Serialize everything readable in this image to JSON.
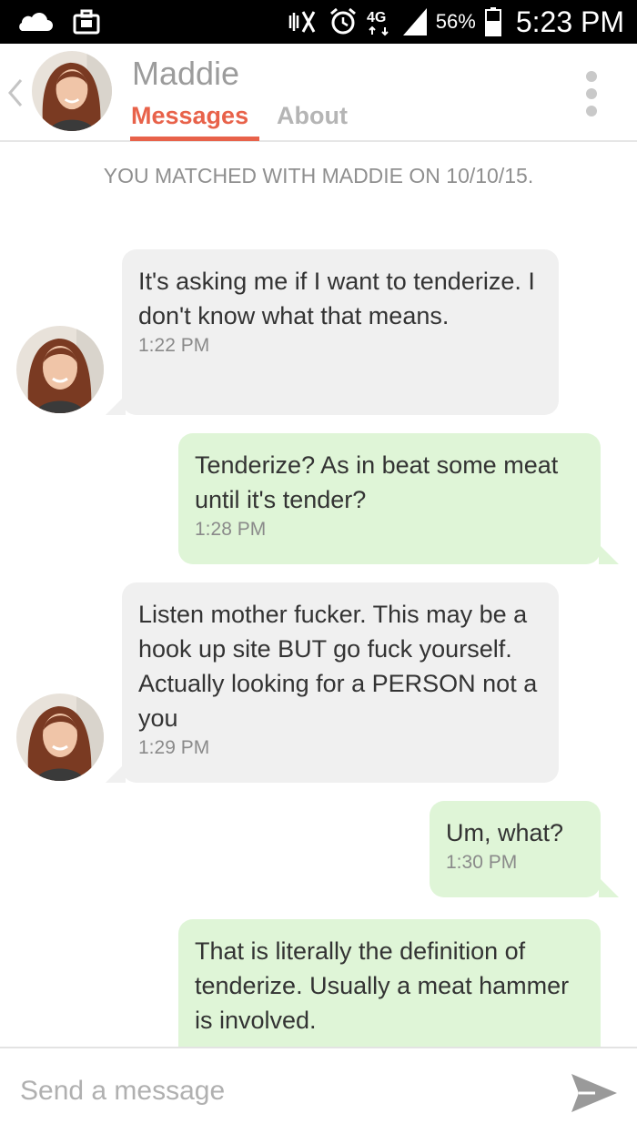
{
  "status_bar": {
    "battery": "56%",
    "time": "5:23 PM",
    "network": "4G",
    "icons": [
      "cloud-icon",
      "briefcase-icon",
      "mute-icon",
      "alarm-icon",
      "signal-icon",
      "battery-icon"
    ]
  },
  "header": {
    "name": "Maddie",
    "tabs": [
      {
        "label": "Messages",
        "active": true
      },
      {
        "label": "About",
        "active": false
      }
    ],
    "accent_color": "#e8624a"
  },
  "conversation": {
    "match_note": "YOU MATCHED WITH MADDIE ON 10/10/15.",
    "messages": [
      {
        "from": "them",
        "text": "It's asking me if I want to tenderize. I don't know what that means.",
        "time": "1:22 PM"
      },
      {
        "from": "me",
        "text": "Tenderize? As in beat some meat until it's tender?",
        "time": "1:28 PM"
      },
      {
        "from": "them",
        "text": "Listen mother fucker. This may be a hook up site BUT go fuck yourself. Actually looking for a PERSON not a you",
        "time": "1:29 PM"
      },
      {
        "from": "me",
        "text": "Um, what?",
        "time": "1:30 PM"
      },
      {
        "from": "me",
        "text": "That is literally the definition of tenderize. Usually a meat hammer is involved.",
        "time": ""
      }
    ]
  },
  "composer": {
    "placeholder": "Send a message"
  },
  "colors": {
    "incoming_bubble": "#f0f0f0",
    "outgoing_bubble": "#dff5d7"
  }
}
